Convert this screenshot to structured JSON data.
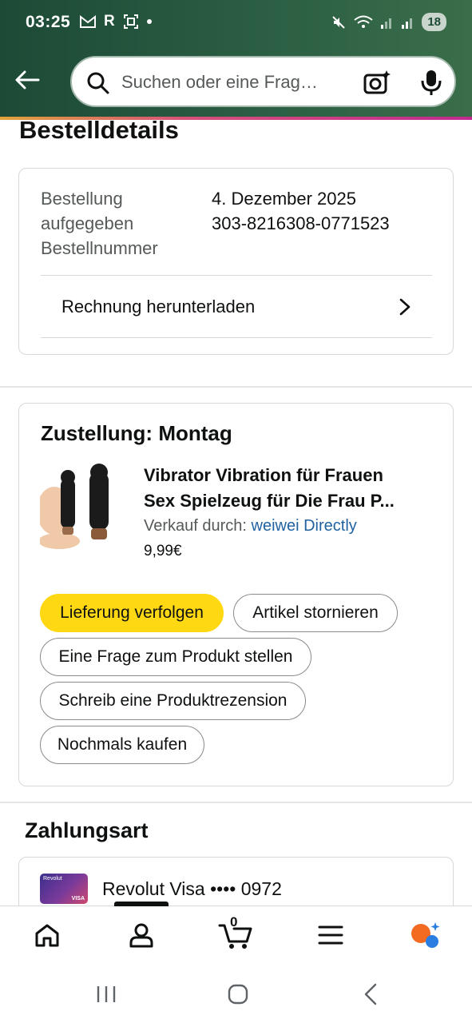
{
  "status_bar": {
    "time": "03:25",
    "left_icons": [
      "M",
      "R"
    ],
    "battery": "18"
  },
  "search": {
    "placeholder": "Suchen oder eine Frag…"
  },
  "page": {
    "title": "Bestelldetails"
  },
  "order": {
    "labels": [
      "Bestellung",
      "aufgegeben",
      "Bestellnummer"
    ],
    "date": "4. Dezember 2025",
    "number": "303-8216308-0771523",
    "invoice_label": "Rechnung herunterladen"
  },
  "delivery": {
    "title": "Zustellung: Montag",
    "product": {
      "name_line1": "Vibrator Vibration für Frauen",
      "name_line2": "Sex Spielzeug für Die Frau P...",
      "seller_prefix": "Verkauf durch: ",
      "seller_name": "weiwei Directly",
      "price": "9,99€"
    },
    "buttons": {
      "track": "Lieferung verfolgen",
      "cancel": "Artikel stornieren",
      "question": "Eine Frage zum Produkt stellen",
      "review": "Schreib eine Produktrezension",
      "buy_again": "Nochmals kaufen"
    }
  },
  "payment": {
    "title": "Zahlungsart",
    "card_text": "Revolut Visa •••• 0972",
    "card_brand": "Revolut",
    "card_network": "VISA"
  },
  "bottom_nav": {
    "cart_count": "0",
    "items": [
      "home-icon",
      "account-icon",
      "cart-icon",
      "menu-icon",
      "rufus-icon"
    ]
  },
  "colors": {
    "header": "#2b5e43",
    "primary_button": "#ffd814",
    "link": "#2162a1"
  }
}
